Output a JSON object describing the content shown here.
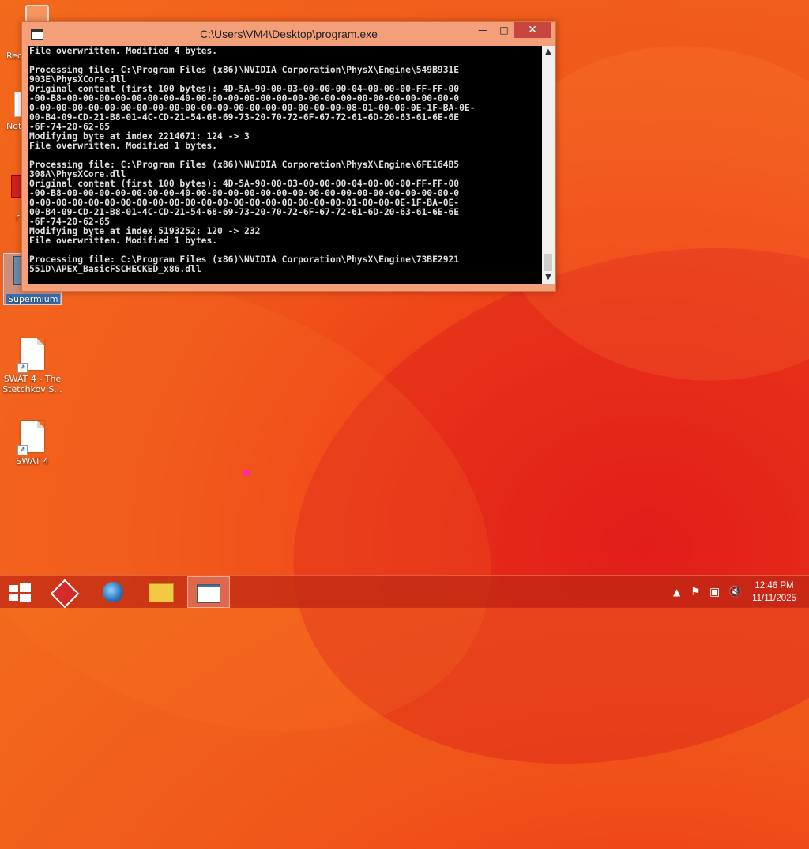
{
  "desktop": {
    "icons": [
      {
        "label": "Rec"
      },
      {
        "label": "Not"
      },
      {
        "label": "r"
      },
      {
        "label": "Supermium"
      },
      {
        "label": "SWAT 4 - The Stetchkov S..."
      },
      {
        "label": "SWAT 4"
      }
    ]
  },
  "window": {
    "title": "C:\\Users\\VM4\\Desktop\\program.exe",
    "minimize": "—",
    "maximize": "□",
    "close": "✕",
    "console_text": "File overwritten. Modified 4 bytes.\n\nProcessing file: C:\\Program Files (x86)\\NVIDIA Corporation\\PhysX\\Engine\\549B931E\n903E\\PhysXCore.dll\nOriginal content (first 100 bytes): 4D-5A-90-00-03-00-00-00-04-00-00-00-FF-FF-00\n-00-B8-00-00-00-00-00-00-00-40-00-00-00-00-00-00-00-00-00-00-00-00-00-00-00-00-0\n0-00-00-00-00-00-00-00-00-00-00-00-00-00-00-00-00-00-00-00-08-01-00-00-0E-1F-BA-0E-\n00-B4-09-CD-21-B8-01-4C-CD-21-54-68-69-73-20-70-72-6F-67-72-61-6D-20-63-61-6E-6E\n-6F-74-20-62-65\nModifying byte at index 2214671: 124 -> 3\nFile overwritten. Modified 1 bytes.\n\nProcessing file: C:\\Program Files (x86)\\NVIDIA Corporation\\PhysX\\Engine\\6FE164B5\n308A\\PhysXCore.dll\nOriginal content (first 100 bytes): 4D-5A-90-00-03-00-00-00-04-00-00-00-FF-FF-00\n-00-B8-00-00-00-00-00-00-00-40-00-00-00-00-00-00-00-00-00-00-00-00-00-00-00-00-0\n0-00-00-00-00-00-00-00-00-00-00-00-00-00-00-00-00-00-00-00-01-00-00-0E-1F-BA-0E-\n00-B4-09-CD-21-B8-01-4C-CD-21-54-68-69-73-20-70-72-6F-67-72-61-6D-20-63-61-6E-6E\n-6F-74-20-62-65\nModifying byte at index 5193252: 120 -> 232\nFile overwritten. Modified 1 bytes.\n\nProcessing file: C:\\Program Files (x86)\\NVIDIA Corporation\\PhysX\\Engine\\73BE2921\n551D\\APEX_BasicFSCHECKED_x86.dll"
  },
  "taskbar": {
    "start_icon": "windows-logo",
    "pinned": [
      {
        "name": "app-icon-red-diamond"
      },
      {
        "name": "browser-icon"
      },
      {
        "name": "file-explorer-icon"
      },
      {
        "name": "console-window-icon"
      }
    ],
    "tray": {
      "show_hidden": "▲",
      "clock_time": "12:46 PM",
      "clock_date": "11/11/2025"
    }
  }
}
